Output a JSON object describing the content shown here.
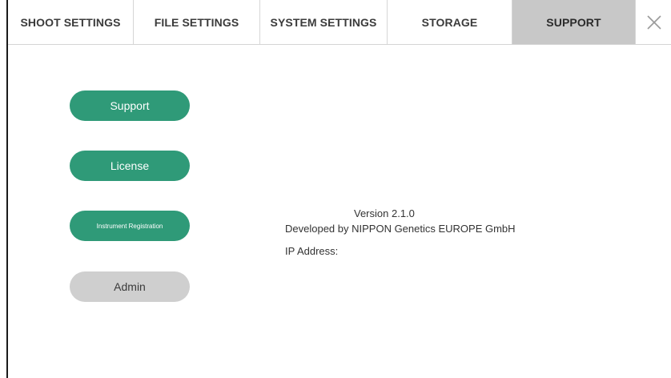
{
  "tabs": [
    {
      "label": "SHOOT SETTINGS",
      "active": false
    },
    {
      "label": "FILE SETTINGS",
      "active": false
    },
    {
      "label": "SYSTEM SETTINGS",
      "active": false
    },
    {
      "label": "STORAGE",
      "active": false
    },
    {
      "label": "SUPPORT",
      "active": true
    }
  ],
  "close": {
    "icon": "close-icon"
  },
  "buttons": {
    "support": "Support",
    "license": "License",
    "instrument_registration": "Instrument Registration",
    "admin": "Admin"
  },
  "info": {
    "version": "Version 2.1.0",
    "developer": "Developed by NIPPON Genetics EUROPE GmbH",
    "ip_address_label": "IP Address:",
    "ip_address_value": ""
  },
  "colors": {
    "accent_green": "#2f9a78",
    "active_tab": "#c8c8c8",
    "disabled_button": "#cfcfcf"
  }
}
